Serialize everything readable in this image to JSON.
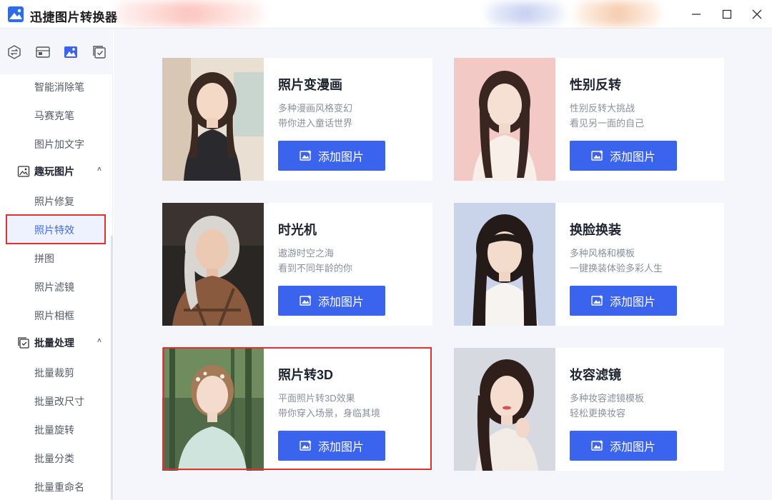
{
  "app": {
    "title": "迅捷图片转换器"
  },
  "sidebar": {
    "top_icons": [
      "convert-icon",
      "layout-icon",
      "image-icon",
      "batch-icon"
    ],
    "items": [
      {
        "label": "智能消除笔"
      },
      {
        "label": "马赛克笔"
      },
      {
        "label": "图片加文字"
      },
      {
        "label": "趣玩图片",
        "group": true
      },
      {
        "label": "照片修复"
      },
      {
        "label": "照片特效",
        "active": true
      },
      {
        "label": "拼图"
      },
      {
        "label": "照片滤镜"
      },
      {
        "label": "照片相框"
      },
      {
        "label": "批量处理",
        "group": true
      },
      {
        "label": "批量裁剪"
      },
      {
        "label": "批量改尺寸"
      },
      {
        "label": "批量旋转"
      },
      {
        "label": "批量分类"
      },
      {
        "label": "批量重命名"
      }
    ]
  },
  "cards": [
    {
      "title": "照片变漫画",
      "desc1": "多种漫画风格变幻",
      "desc2": "带你进入童话世界",
      "button": "添加图片"
    },
    {
      "title": "性别反转",
      "desc1": "性别反转大挑战",
      "desc2": "看见另一面的自己",
      "button": "添加图片"
    },
    {
      "title": "时光机",
      "desc1": "遨游时空之海",
      "desc2": "看到不同年龄的你",
      "button": "添加图片"
    },
    {
      "title": "换脸换装",
      "desc1": "多种风格和模板",
      "desc2": "一键换装体验多彩人生",
      "button": "添加图片"
    },
    {
      "title": "照片转3D",
      "desc1": "平面照片转3D效果",
      "desc2": "带你穿入场景，身临其境",
      "button": "添加图片"
    },
    {
      "title": "妆容滤镜",
      "desc1": "多种妆容滤镜模板",
      "desc2": "轻松更换妆容",
      "button": "添加图片"
    }
  ],
  "colors": {
    "accent": "#3a64ee",
    "highlight": "#e0302f",
    "active_text": "#3f6af5"
  }
}
